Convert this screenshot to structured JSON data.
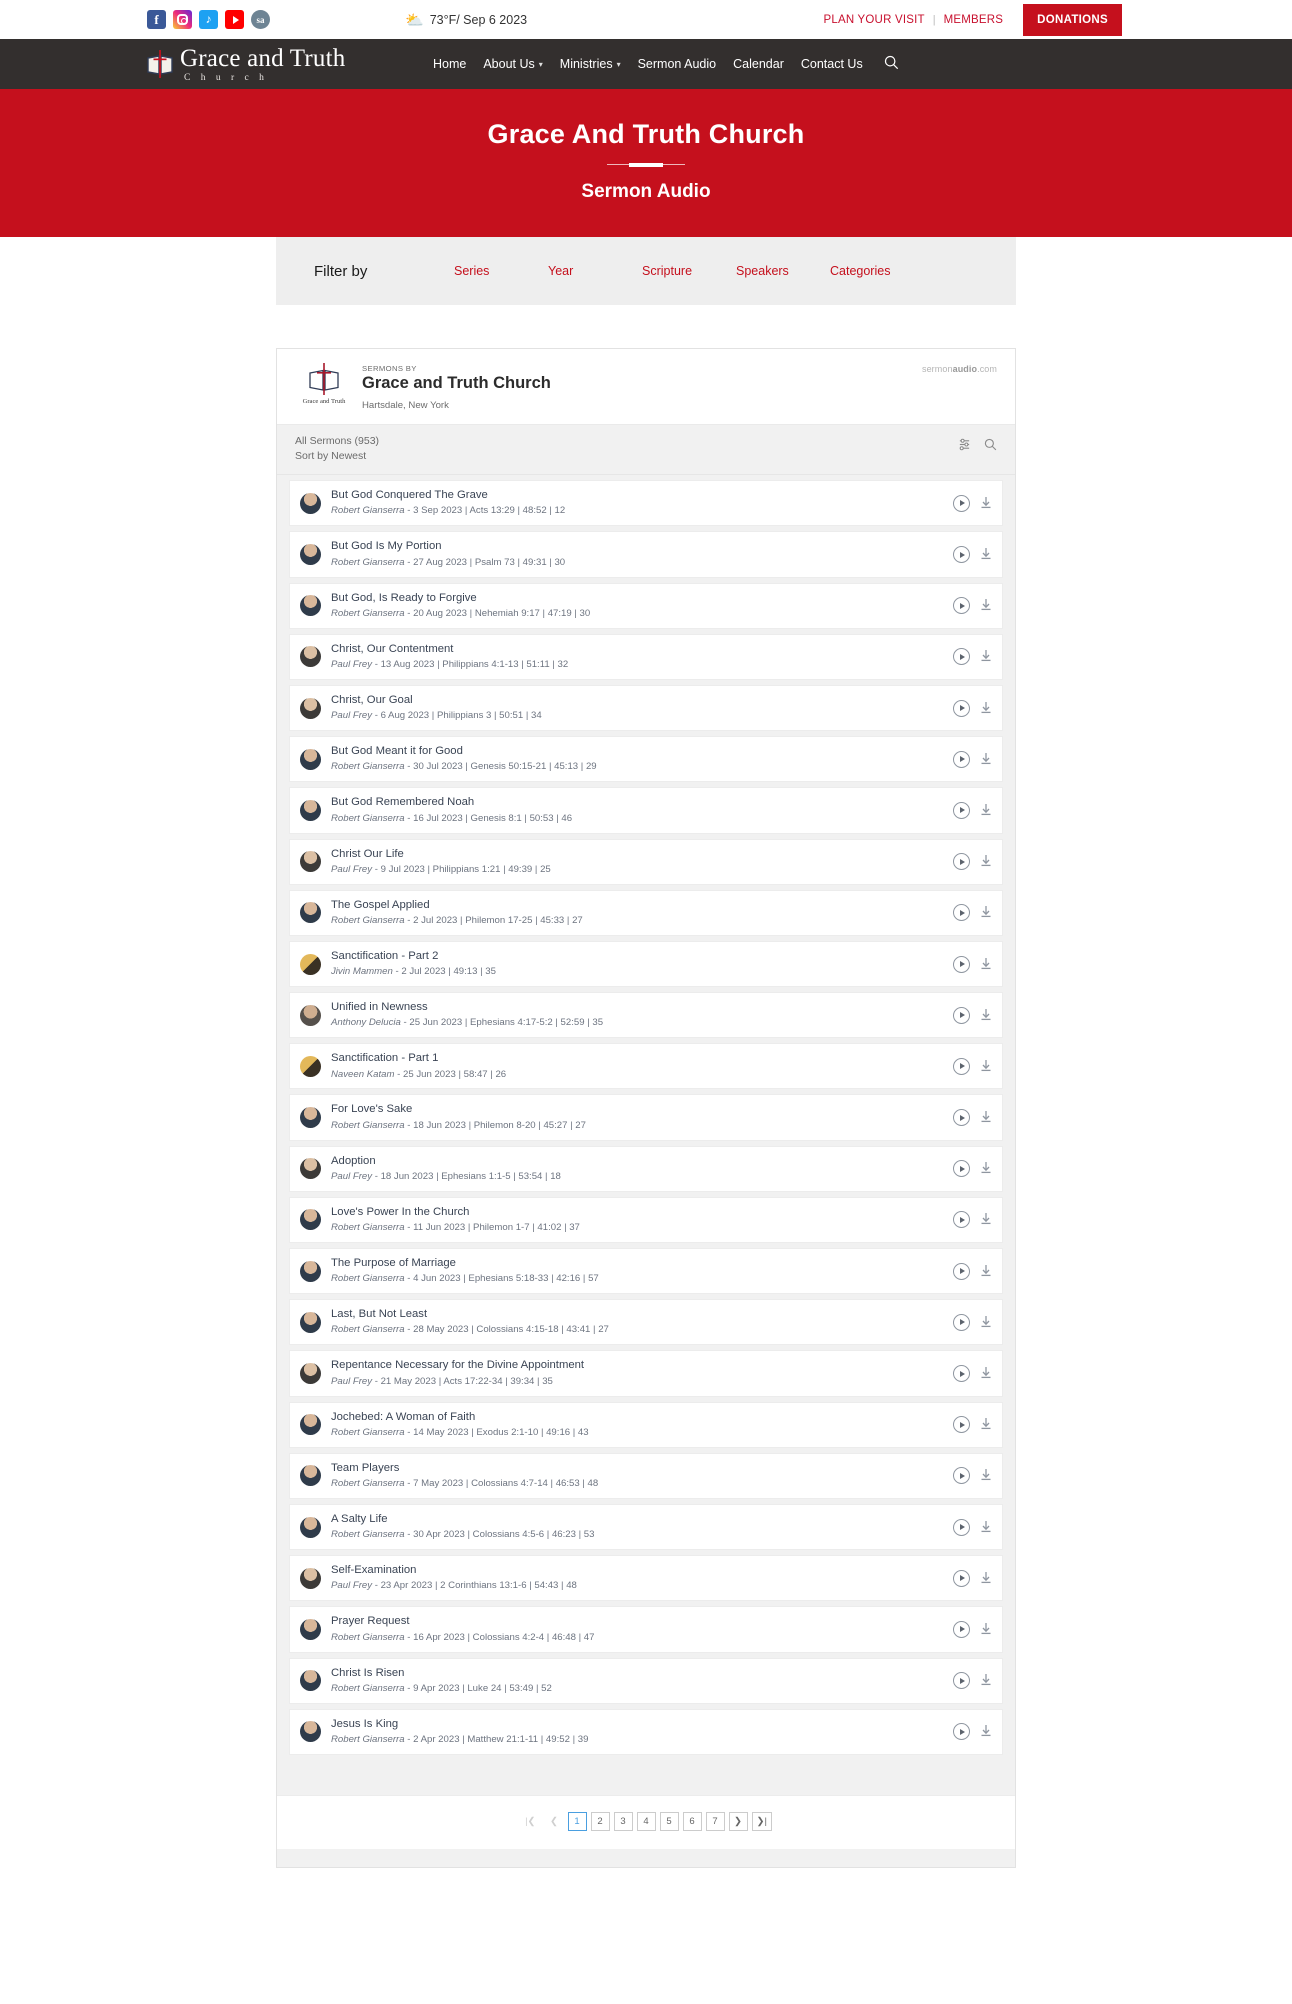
{
  "topbar": {
    "social": [
      {
        "name": "facebook-icon",
        "glyph": "f"
      },
      {
        "name": "instagram-icon",
        "glyph": ""
      },
      {
        "name": "twitter-icon",
        "glyph": "ᵗ"
      },
      {
        "name": "youtube-icon",
        "glyph": ""
      },
      {
        "name": "sermonaudio-icon",
        "glyph": "sa"
      }
    ],
    "weather": "73°F/ Sep 6 2023",
    "weather_icon": "⛅",
    "plan_visit": "PLAN YOUR VISIT",
    "separator": "|",
    "members": "MEMBERS",
    "donations": "DONATIONS"
  },
  "nav": {
    "brand_name": "Grace and Truth",
    "brand_sub": "C h u r c h",
    "items": [
      {
        "label": "Home",
        "caret": false
      },
      {
        "label": "About Us",
        "caret": true
      },
      {
        "label": "Ministries",
        "caret": true
      },
      {
        "label": "Sermon Audio",
        "caret": false
      },
      {
        "label": "Calendar",
        "caret": false
      },
      {
        "label": "Contact Us",
        "caret": false
      }
    ],
    "caret_glyph": "▾",
    "search_glyph": "⌕"
  },
  "hero": {
    "title": "Grace And Truth Church",
    "subtitle": "Sermon Audio"
  },
  "filter": {
    "label": "Filter by",
    "options": [
      "Series",
      "Year",
      "Scripture",
      "Speakers",
      "Categories"
    ]
  },
  "widget": {
    "logo_label": "Grace and Truth",
    "eyebrow": "SERMONS BY",
    "title": "Grace and Truth Church",
    "location": "Hartsdale, New York",
    "brand_pre": "sermon",
    "brand_bold": "audio",
    "brand_post": ".com",
    "count": "All Sermons (953)",
    "sort": "Sort by Newest",
    "filter_icon": "≡",
    "search_icon": "⌕",
    "play_icon": "play-icon",
    "download_icon": "⬇"
  },
  "colors": {
    "accent_red": "#c5101d",
    "nav_dark": "#332f2e",
    "link_blue": "#4a9fe0",
    "title_slate": "#3a4454"
  },
  "sermons": [
    {
      "title": "But God Conquered The Grave",
      "speaker": "Robert Gianserra",
      "date": "3 Sep 2023",
      "scripture": "Acts 13:29",
      "duration": "48:52",
      "plays": "12",
      "avatar": "head1"
    },
    {
      "title": "But God Is My Portion",
      "speaker": "Robert Gianserra",
      "date": "27 Aug 2023",
      "scripture": "Psalm 73",
      "duration": "49:31",
      "plays": "30",
      "avatar": "head1"
    },
    {
      "title": "But God, Is Ready to Forgive",
      "speaker": "Robert Gianserra",
      "date": "20 Aug 2023",
      "scripture": "Nehemiah 9:17",
      "duration": "47:19",
      "plays": "30",
      "avatar": "head1"
    },
    {
      "title": "Christ, Our Contentment",
      "speaker": "Paul Frey",
      "date": "13 Aug 2023",
      "scripture": "Philippians 4:1-13",
      "duration": "51:11",
      "plays": "32",
      "avatar": "head2"
    },
    {
      "title": "Christ, Our Goal",
      "speaker": "Paul Frey",
      "date": "6 Aug 2023",
      "scripture": "Philippians 3",
      "duration": "50:51",
      "plays": "34",
      "avatar": "head2"
    },
    {
      "title": "But God Meant it for Good",
      "speaker": "Robert Gianserra",
      "date": "30 Jul 2023",
      "scripture": "Genesis 50:15-21",
      "duration": "45:13",
      "plays": "29",
      "avatar": "head1"
    },
    {
      "title": "But God Remembered Noah",
      "speaker": "Robert Gianserra",
      "date": "16 Jul 2023",
      "scripture": "Genesis 8:1",
      "duration": "50:53",
      "plays": "46",
      "avatar": "head1"
    },
    {
      "title": "Christ Our Life",
      "speaker": "Paul Frey",
      "date": "9 Jul 2023",
      "scripture": "Philippians 1:21",
      "duration": "49:39",
      "plays": "25",
      "avatar": "head2"
    },
    {
      "title": "The Gospel Applied",
      "speaker": "Robert Gianserra",
      "date": "2 Jul 2023",
      "scripture": "Philemon 17-25",
      "duration": "45:33",
      "plays": "27",
      "avatar": "head1"
    },
    {
      "title": "Sanctification - Part 2",
      "speaker": "Jivin Mammen",
      "date": "2 Jul 2023",
      "scripture": "",
      "duration": "49:13",
      "plays": "35",
      "avatar": "gold"
    },
    {
      "title": "Unified in Newness",
      "speaker": "Anthony Delucia",
      "date": "25 Jun 2023",
      "scripture": "Ephesians 4:17-5:2",
      "duration": "52:59",
      "plays": "35",
      "avatar": "head3"
    },
    {
      "title": "Sanctification - Part 1",
      "speaker": "Naveen Katam",
      "date": "25 Jun 2023",
      "scripture": "",
      "duration": "58:47",
      "plays": "26",
      "avatar": "gold"
    },
    {
      "title": "For Love's Sake",
      "speaker": "Robert Gianserra",
      "date": "18 Jun 2023",
      "scripture": "Philemon 8-20",
      "duration": "45:27",
      "plays": "27",
      "avatar": "head1"
    },
    {
      "title": "Adoption",
      "speaker": "Paul Frey",
      "date": "18 Jun 2023",
      "scripture": "Ephesians 1:1-5",
      "duration": "53:54",
      "plays": "18",
      "avatar": "head2"
    },
    {
      "title": "Love's Power In the Church",
      "speaker": "Robert Gianserra",
      "date": "11 Jun 2023",
      "scripture": "Philemon 1-7",
      "duration": "41:02",
      "plays": "37",
      "avatar": "head1"
    },
    {
      "title": "The Purpose of Marriage",
      "speaker": "Robert Gianserra",
      "date": "4 Jun 2023",
      "scripture": "Ephesians 5:18-33",
      "duration": "42:16",
      "plays": "57",
      "avatar": "head1"
    },
    {
      "title": "Last, But Not Least",
      "speaker": "Robert Gianserra",
      "date": "28 May 2023",
      "scripture": "Colossians 4:15-18",
      "duration": "43:41",
      "plays": "27",
      "avatar": "head1"
    },
    {
      "title": "Repentance Necessary for the Divine Appointment",
      "speaker": "Paul Frey",
      "date": "21 May 2023",
      "scripture": "Acts 17:22-34",
      "duration": "39:34",
      "plays": "35",
      "avatar": "head2"
    },
    {
      "title": "Jochebed: A Woman of Faith",
      "speaker": "Robert Gianserra",
      "date": "14 May 2023",
      "scripture": "Exodus 2:1-10",
      "duration": "49:16",
      "plays": "43",
      "avatar": "head1"
    },
    {
      "title": "Team Players",
      "speaker": "Robert Gianserra",
      "date": "7 May 2023",
      "scripture": "Colossians 4:7-14",
      "duration": "46:53",
      "plays": "48",
      "avatar": "head1"
    },
    {
      "title": "A Salty Life",
      "speaker": "Robert Gianserra",
      "date": "30 Apr 2023",
      "scripture": "Colossians 4:5-6",
      "duration": "46:23",
      "plays": "53",
      "avatar": "head1"
    },
    {
      "title": "Self-Examination",
      "speaker": "Paul Frey",
      "date": "23 Apr 2023",
      "scripture": "2 Corinthians 13:1-6",
      "duration": "54:43",
      "plays": "48",
      "avatar": "head2"
    },
    {
      "title": "Prayer Request",
      "speaker": "Robert Gianserra",
      "date": "16 Apr 2023",
      "scripture": "Colossians 4:2-4",
      "duration": "46:48",
      "plays": "47",
      "avatar": "head1"
    },
    {
      "title": "Christ Is Risen",
      "speaker": "Robert Gianserra",
      "date": "9 Apr 2023",
      "scripture": "Luke 24",
      "duration": "53:49",
      "plays": "52",
      "avatar": "head1"
    },
    {
      "title": "Jesus Is King",
      "speaker": "Robert Gianserra",
      "date": "2 Apr 2023",
      "scripture": "Matthew 21:1-11",
      "duration": "49:52",
      "plays": "39",
      "avatar": "head1"
    }
  ],
  "pagination": {
    "first": "|❮",
    "prev": "❮",
    "pages": [
      "1",
      "2",
      "3",
      "4",
      "5",
      "6",
      "7"
    ],
    "active": "1",
    "next": "❯",
    "last": "❯|"
  }
}
